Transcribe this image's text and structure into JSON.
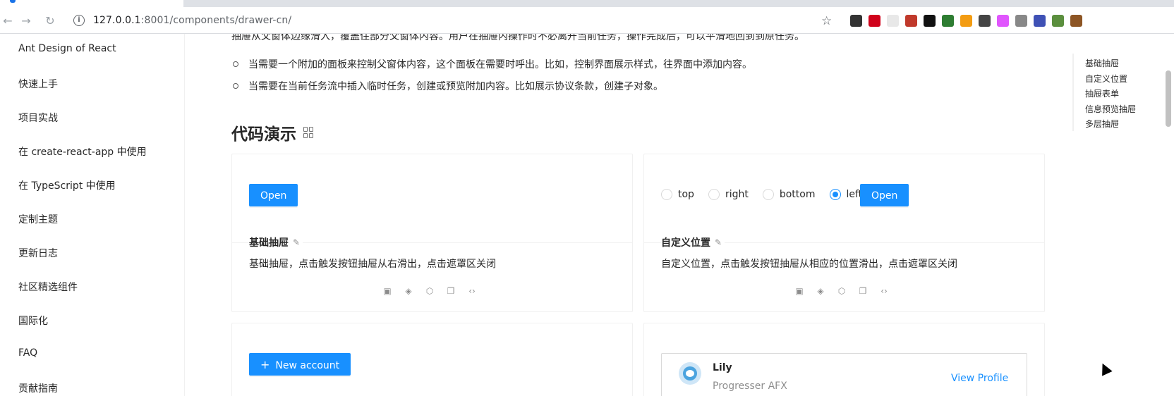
{
  "browser": {
    "url_host": "127.0.0.1",
    "url_path": ":8001/components/drawer-cn/",
    "extensions": [
      "#333333",
      "#d0021b",
      "#e8e8e8",
      "#c0392b",
      "#111111",
      "#2e7d32",
      "#f39c12",
      "#444444",
      "#e056fd",
      "#888888",
      "#3f51b5",
      "#5b8f3e",
      "#8d5524"
    ]
  },
  "sidebar": {
    "items": [
      "Ant Design of React",
      "快速上手",
      "项目实战",
      "在 create-react-app 中使用",
      "在 TypeScript 中使用",
      "定制主题",
      "更新日志",
      "社区精选组件",
      "国际化",
      "FAQ",
      "贡献指南"
    ]
  },
  "content": {
    "intro_partial": "抽屉从父窗体边缘滑入，覆盖住部分父窗体内容。用户在抽屉内操作时不必离开当前任务，操作完成后，可以平滑地回到到原任务。",
    "bullets": [
      "当需要一个附加的面板来控制父窗体内容，这个面板在需要时呼出。比如，控制界面展示样式，往界面中添加内容。",
      "当需要在当前任务流中插入临时任务，创建或预览附加内容。比如展示协议条款，创建子对象。"
    ],
    "section_title": "代码演示"
  },
  "demos": {
    "basic": {
      "button": "Open",
      "title": "基础抽屉",
      "desc": "基础抽屉，点击触发按钮抽屉从右滑出，点击遮罩区关闭"
    },
    "placement": {
      "radios": [
        "top",
        "right",
        "bottom",
        "left"
      ],
      "selected": "left",
      "button": "Open",
      "title": "自定义位置",
      "desc": "自定义位置，点击触发按钮抽屉从相应的位置滑出，点击遮罩区关闭"
    },
    "form": {
      "button": "New account"
    },
    "preview": {
      "name": "Lily",
      "subtitle": "Progresser AFX",
      "link": "View Profile"
    }
  },
  "anchor": {
    "items": [
      "基础抽屉",
      "自定义位置",
      "抽屉表单",
      "信息预览抽屉",
      "多层抽屉"
    ]
  },
  "colors": {
    "primary": "#1890ff",
    "border": "#f0f0f0"
  }
}
